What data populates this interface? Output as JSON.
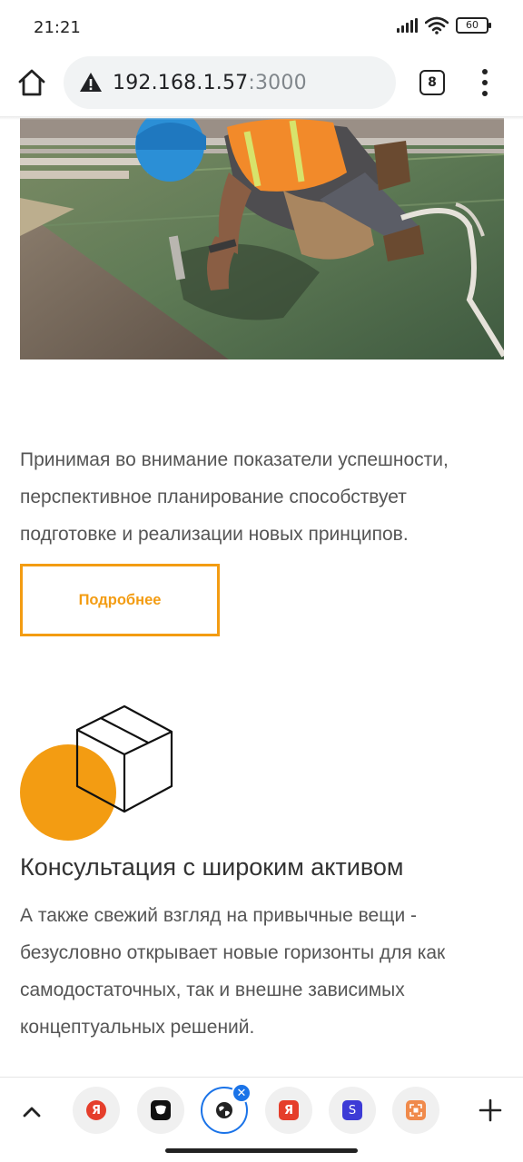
{
  "status_bar": {
    "time": "21:21",
    "battery": "60"
  },
  "browser": {
    "url_host": "192.168.1.57",
    "url_port": ":3000",
    "tab_count": "8"
  },
  "content": {
    "paragraph_1": "Принимая во внимание показатели успешности, перспективное планирование способствует подготовке и реализации новых принципов.",
    "more_button": "Подробнее",
    "feature_title": "Консультация с широким активом",
    "paragraph_2": "А также свежий взгляд на привычные вещи - безусловно открывает новые горизонты для как самодостаточных, так и внешне зависимых концептуальных решений."
  },
  "toolbar": {
    "tabs": [
      {
        "icon": "yandex-icon",
        "glyph": "Я",
        "color": "#e53e2b"
      },
      {
        "icon": "app-icon",
        "glyph": "",
        "color": "#111111"
      },
      {
        "icon": "globe-icon",
        "glyph": "",
        "color": "#222222"
      },
      {
        "icon": "yandex-icon",
        "glyph": "Я",
        "color": "#e53e2b"
      },
      {
        "icon": "s-icon",
        "glyph": "S",
        "color": "#3d3bd6"
      },
      {
        "icon": "fullscreen-icon",
        "glyph": "",
        "color": "#f08a4b"
      }
    ]
  },
  "colors": {
    "accent": "#f39c12",
    "browser_active": "#1a73e8"
  }
}
